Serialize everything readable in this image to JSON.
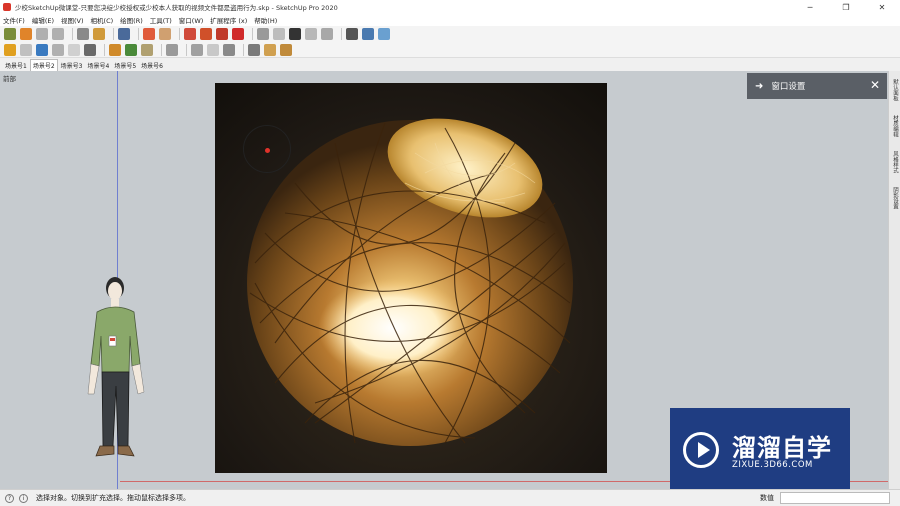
{
  "window": {
    "title": "少校SketchUp微课堂-只要您决绽少校授权或少校本人获取的视频文件都是盗用行为.skp - SketchUp Pro 2020",
    "minimize_glyph": "─",
    "maximize_glyph": "❐",
    "close_glyph": "✕"
  },
  "menu": {
    "items": [
      {
        "label": "文件(F)"
      },
      {
        "label": "编辑(E)"
      },
      {
        "label": "视图(V)"
      },
      {
        "label": "相机(C)"
      },
      {
        "label": "绘图(R)"
      },
      {
        "label": "工具(T)"
      },
      {
        "label": "窗口(W)"
      },
      {
        "label": "扩展程序 (x)"
      },
      {
        "label": "帮助(H)"
      }
    ]
  },
  "scenes": {
    "tabs": [
      {
        "label": "场景号1"
      },
      {
        "label": "场景号2"
      },
      {
        "label": "场景号3"
      },
      {
        "label": "场景号4"
      },
      {
        "label": "场景号5"
      },
      {
        "label": "场景号6"
      }
    ]
  },
  "viewport": {
    "label": "前部"
  },
  "panel": {
    "title": "窗口设置",
    "arrow": "➜",
    "close": "✕"
  },
  "tray": {
    "tabs": [
      {
        "label": "默认面板"
      },
      {
        "label": "材质编辑"
      },
      {
        "label": "风格样式"
      },
      {
        "label": "阴影设置"
      }
    ]
  },
  "watermark": {
    "title": "溜溜自学",
    "url": "ZIXUE.3D66.COM"
  },
  "status": {
    "text": "选择对象。切换到扩充选择。拖动鼠标选择多项。",
    "measure_label": "数值",
    "measure_value": ""
  },
  "colors": {
    "accent": "#1f3d82",
    "panel_header": "#5a5f66",
    "viewport_bg": "#c6cbcf",
    "cursor_dot": "#e0322a"
  }
}
